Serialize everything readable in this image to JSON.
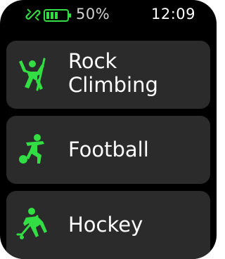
{
  "status": {
    "battery_percent": "50%",
    "battery_level": 0.5,
    "time": "12:09",
    "link_icon": "link-broken-icon",
    "battery_icon": "battery-icon"
  },
  "colors": {
    "accent": "#33dd44",
    "card": "#2b2b2b",
    "background": "#000000",
    "text": "#ffffff"
  },
  "activities": [
    {
      "label": "Rock\nClimbing",
      "icon": "rock-climbing-icon"
    },
    {
      "label": "Football",
      "icon": "football-icon"
    },
    {
      "label": "Hockey",
      "icon": "hockey-icon"
    }
  ]
}
